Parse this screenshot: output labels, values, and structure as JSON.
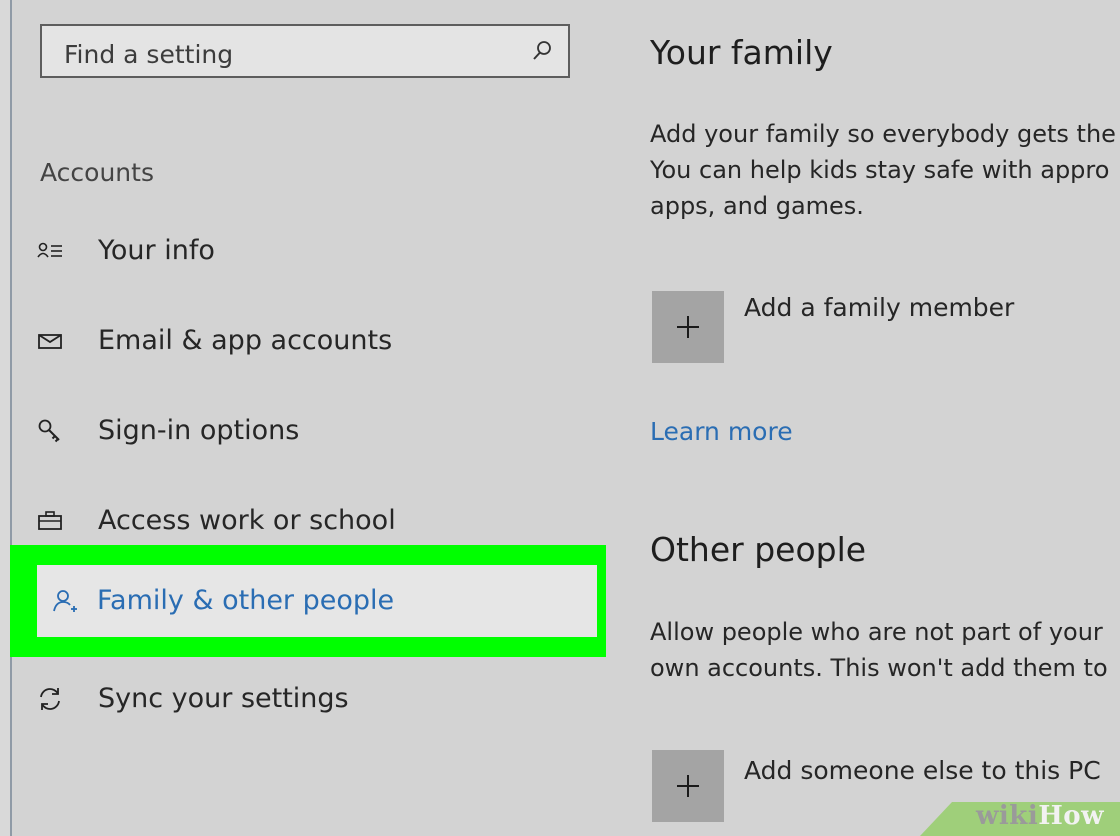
{
  "search": {
    "placeholder": "Find a setting",
    "icon": "search-icon"
  },
  "sidebar": {
    "section_title": "Accounts",
    "items": [
      {
        "label": "Your info",
        "icon": "user-info-icon"
      },
      {
        "label": "Email & app accounts",
        "icon": "mail-icon"
      },
      {
        "label": "Sign-in options",
        "icon": "key-icon"
      },
      {
        "label": "Access work or school",
        "icon": "briefcase-icon"
      },
      {
        "label": "Family & other people",
        "icon": "person-add-icon",
        "selected": true
      },
      {
        "label": "Sync your settings",
        "icon": "sync-icon"
      }
    ]
  },
  "main": {
    "family": {
      "title": "Your family",
      "desc_lines": [
        "Add your family so everybody gets the",
        "You can help kids stay safe with appro",
        "apps, and games."
      ],
      "add_label": "Add a family member",
      "learn_more": "Learn more"
    },
    "other": {
      "title": "Other people",
      "desc_lines": [
        "Allow people who are not part of your",
        "own accounts. This won't add them to"
      ],
      "add_label": "Add someone else to this PC"
    }
  },
  "watermark": {
    "part1": "wiki",
    "part2": "How"
  },
  "colors": {
    "highlight": "#00ff00",
    "link": "#2a6db3",
    "background": "#d3d3d3",
    "tile": "#a4a4a4"
  }
}
